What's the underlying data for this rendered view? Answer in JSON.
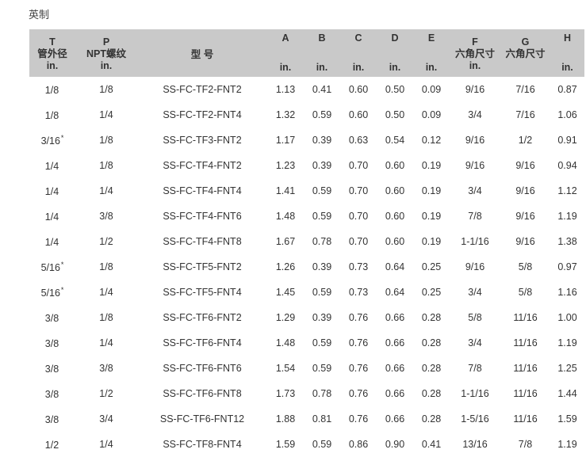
{
  "caption": "英制",
  "header": {
    "t": {
      "letter": "T",
      "name": "管外径",
      "unit": "in."
    },
    "p": {
      "letter": "P",
      "name": "NPT螺纹",
      "unit": "in."
    },
    "model": {
      "name": "型 号"
    },
    "a": {
      "letter": "A",
      "unit": "in."
    },
    "b": {
      "letter": "B",
      "unit": "in."
    },
    "c": {
      "letter": "C",
      "unit": "in."
    },
    "d": {
      "letter": "D",
      "unit": "in."
    },
    "e": {
      "letter": "E",
      "unit": "in."
    },
    "f": {
      "letter": "F",
      "name": "六角尺寸",
      "unit": "in."
    },
    "g": {
      "letter": "G",
      "name": "六角尺寸",
      "unit": ""
    },
    "h": {
      "letter": "H",
      "unit": "in."
    }
  },
  "rows": [
    {
      "t": "1/8",
      "t_mark": "",
      "p": "1/8",
      "model": "SS-FC-TF2-FNT2",
      "a": "1.13",
      "b": "0.41",
      "c": "0.60",
      "d": "0.50",
      "e": "0.09",
      "f": "9/16",
      "g": "7/16",
      "h": "0.87"
    },
    {
      "t": "1/8",
      "t_mark": "",
      "p": "1/4",
      "model": "SS-FC-TF2-FNT4",
      "a": "1.32",
      "b": "0.59",
      "c": "0.60",
      "d": "0.50",
      "e": "0.09",
      "f": "3/4",
      "g": "7/16",
      "h": "1.06"
    },
    {
      "t": "3/16",
      "t_mark": "*",
      "p": "1/8",
      "model": "SS-FC-TF3-FNT2",
      "a": "1.17",
      "b": "0.39",
      "c": "0.63",
      "d": "0.54",
      "e": "0.12",
      "f": "9/16",
      "g": "1/2",
      "h": "0.91"
    },
    {
      "t": "1/4",
      "t_mark": "",
      "p": "1/8",
      "model": "SS-FC-TF4-FNT2",
      "a": "1.23",
      "b": "0.39",
      "c": "0.70",
      "d": "0.60",
      "e": "0.19",
      "f": "9/16",
      "g": "9/16",
      "h": "0.94"
    },
    {
      "t": "1/4",
      "t_mark": "",
      "p": "1/4",
      "model": "SS-FC-TF4-FNT4",
      "a": "1.41",
      "b": "0.59",
      "c": "0.70",
      "d": "0.60",
      "e": "0.19",
      "f": "3/4",
      "g": "9/16",
      "h": "1.12"
    },
    {
      "t": "1/4",
      "t_mark": "",
      "p": "3/8",
      "model": "SS-FC-TF4-FNT6",
      "a": "1.48",
      "b": "0.59",
      "c": "0.70",
      "d": "0.60",
      "e": "0.19",
      "f": "7/8",
      "g": "9/16",
      "h": "1.19"
    },
    {
      "t": "1/4",
      "t_mark": "",
      "p": "1/2",
      "model": "SS-FC-TF4-FNT8",
      "a": "1.67",
      "b": "0.78",
      "c": "0.70",
      "d": "0.60",
      "e": "0.19",
      "f": "1-1/16",
      "g": "9/16",
      "h": "1.38"
    },
    {
      "t": "5/16",
      "t_mark": "*",
      "p": "1/8",
      "model": "SS-FC-TF5-FNT2",
      "a": "1.26",
      "b": "0.39",
      "c": "0.73",
      "d": "0.64",
      "e": "0.25",
      "f": "9/16",
      "g": "5/8",
      "h": "0.97"
    },
    {
      "t": "5/16",
      "t_mark": "*",
      "p": "1/4",
      "model": "SS-FC-TF5-FNT4",
      "a": "1.45",
      "b": "0.59",
      "c": "0.73",
      "d": "0.64",
      "e": "0.25",
      "f": "3/4",
      "g": "5/8",
      "h": "1.16"
    },
    {
      "t": "3/8",
      "t_mark": "",
      "p": "1/8",
      "model": "SS-FC-TF6-FNT2",
      "a": "1.29",
      "b": "0.39",
      "c": "0.76",
      "d": "0.66",
      "e": "0.28",
      "f": "5/8",
      "g": "11/16",
      "h": "1.00"
    },
    {
      "t": "3/8",
      "t_mark": "",
      "p": "1/4",
      "model": "SS-FC-TF6-FNT4",
      "a": "1.48",
      "b": "0.59",
      "c": "0.76",
      "d": "0.66",
      "e": "0.28",
      "f": "3/4",
      "g": "11/16",
      "h": "1.19"
    },
    {
      "t": "3/8",
      "t_mark": "",
      "p": "3/8",
      "model": "SS-FC-TF6-FNT6",
      "a": "1.54",
      "b": "0.59",
      "c": "0.76",
      "d": "0.66",
      "e": "0.28",
      "f": "7/8",
      "g": "11/16",
      "h": "1.25"
    },
    {
      "t": "3/8",
      "t_mark": "",
      "p": "1/2",
      "model": "SS-FC-TF6-FNT8",
      "a": "1.73",
      "b": "0.78",
      "c": "0.76",
      "d": "0.66",
      "e": "0.28",
      "f": "1-1/16",
      "g": "11/16",
      "h": "1.44"
    },
    {
      "t": "3/8",
      "t_mark": "",
      "p": "3/4",
      "model": "SS-FC-TF6-FNT12",
      "a": "1.88",
      "b": "0.81",
      "c": "0.76",
      "d": "0.66",
      "e": "0.28",
      "f": "1-5/16",
      "g": "11/16",
      "h": "1.59"
    },
    {
      "t": "1/2",
      "t_mark": "",
      "p": "1/4",
      "model": "SS-FC-TF8-FNT4",
      "a": "1.59",
      "b": "0.59",
      "c": "0.86",
      "d": "0.90",
      "e": "0.41",
      "f": "13/16",
      "g": "7/8",
      "h": "1.19"
    }
  ]
}
